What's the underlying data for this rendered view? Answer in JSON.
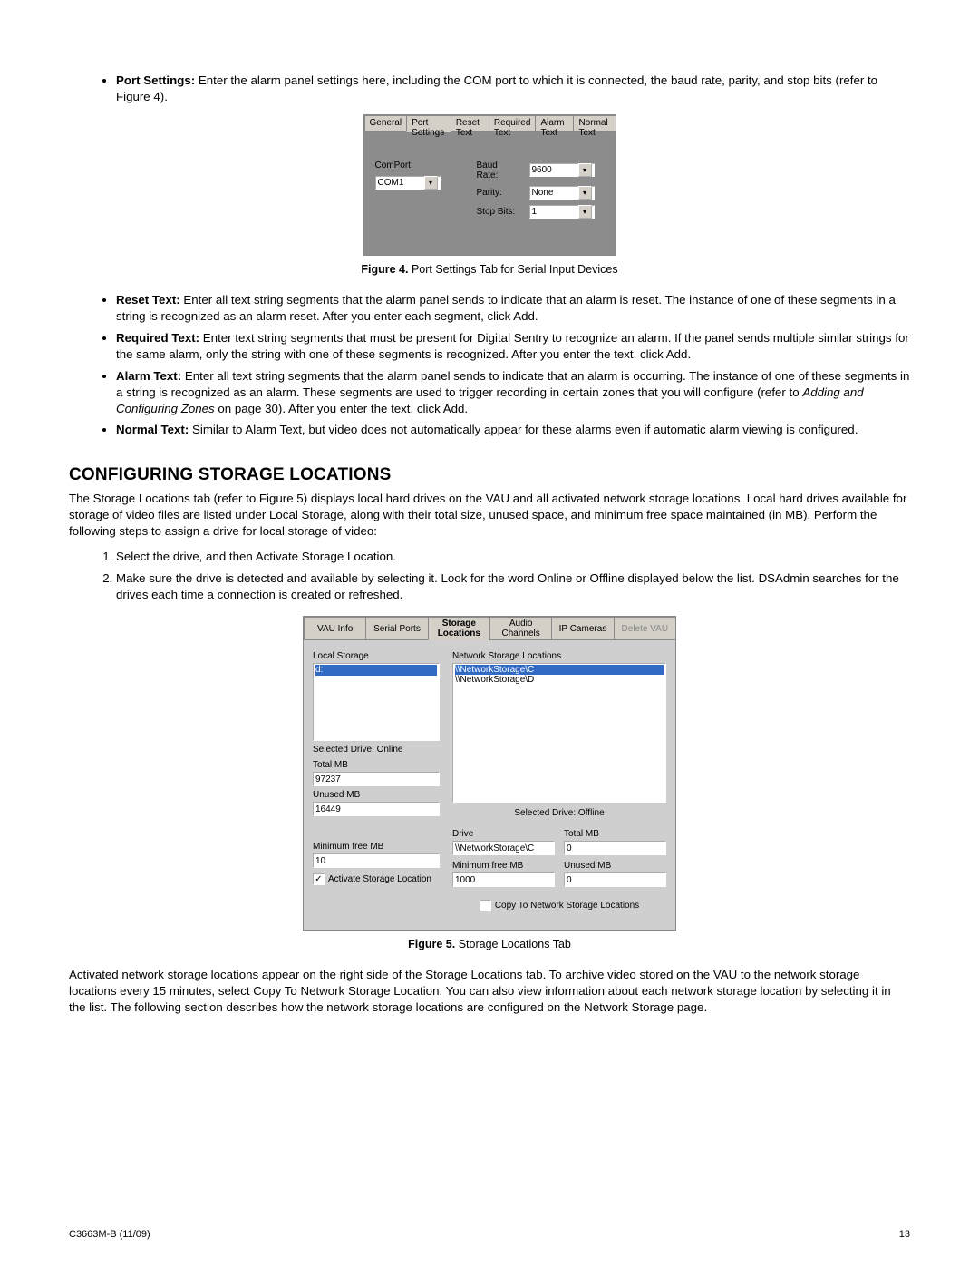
{
  "bullets1": {
    "port_settings_label": "Port Settings:",
    "port_settings_text": " Enter the alarm panel settings here, including the COM port to which it is connected, the baud rate, parity, and stop bits (refer to Figure 4)."
  },
  "fig4": {
    "tabs": [
      "General",
      "Port Settings",
      "Reset Text",
      "Required Text",
      "Alarm Text",
      "Normal Text"
    ],
    "comport_label": "ComPort:",
    "comport_value": "COM1",
    "baud_label": "Baud Rate:",
    "baud_value": "9600",
    "parity_label": "Parity:",
    "parity_value": "None",
    "stopbits_label": "Stop Bits:",
    "stopbits_value": "1",
    "caption_label": "Figure 4.",
    "caption_text": "  Port Settings Tab for Serial Input Devices"
  },
  "bullets2": {
    "reset_label": "Reset Text:",
    "reset_text": " Enter all text string segments that the alarm panel sends to indicate that an alarm is reset. The instance of one of these segments in a string is recognized as an alarm reset. After you enter each segment, click Add.",
    "required_label": "Required Text:",
    "required_text": " Enter text string segments that must be present for Digital Sentry to recognize an alarm. If the panel sends multiple similar strings for the same alarm, only the string with one of these segments is recognized. After you enter the text, click Add.",
    "alarm_label": "Alarm Text:",
    "alarm_text_a": " Enter all text string segments that the alarm panel sends to indicate that an alarm is occurring. The instance of one of these segments in a string is recognized as an alarm. These segments are used to trigger recording in certain zones that you will configure (refer to ",
    "alarm_text_italic": "Adding and Configuring Zones",
    "alarm_text_b": " on page 30). After you enter the text, click Add.",
    "normal_label": "Normal Text:",
    "normal_text": " Similar to Alarm Text, but video does not automatically appear for these alarms even if automatic alarm viewing is configured."
  },
  "section_heading": "CONFIGURING STORAGE LOCATIONS",
  "section_para": "The Storage Locations tab (refer to Figure 5) displays local hard drives on the VAU and all activated network storage locations. Local hard drives available for storage of video files are listed under Local Storage, along with their total size, unused space, and minimum free space maintained (in MB). Perform the following steps to assign a drive for local storage of video:",
  "steps": {
    "s1": "Select the drive, and then Activate Storage Location.",
    "s2": "Make sure the drive is detected and available by selecting it. Look for the word Online or Offline displayed below the list. DSAdmin searches for the drives each time a connection is created or refreshed."
  },
  "fig5": {
    "tabs": [
      "VAU Info",
      "Serial Ports",
      "Storage Locations",
      "Audio Channels",
      "IP Cameras",
      "Delete VAU"
    ],
    "local_storage_label": "Local Storage",
    "drive_item": "d:",
    "selected_drive_status": "Selected Drive: Online",
    "total_mb_label": "Total MB",
    "total_mb_value": "97237",
    "unused_mb_label": "Unused MB",
    "unused_mb_value": "16449",
    "min_free_label": "Minimum free MB",
    "min_free_value": "10",
    "activate_label": "Activate Storage Location",
    "net_loc_label": "Network Storage Locations",
    "net_item1": "\\\\NetworkStorage\\C",
    "net_item2": "\\\\NetworkStorage\\D",
    "net_selected_status": "Selected Drive: Offline",
    "drive_label": "Drive",
    "drive_value": "\\\\NetworkStorage\\C",
    "net_total_label": "Total MB",
    "net_total_value": "0",
    "net_min_label": "Minimum free MB",
    "net_min_value": "1000",
    "net_unused_label": "Unused MB",
    "net_unused_value": "0",
    "copy_label": "Copy To Network Storage Locations",
    "caption_label": "Figure 5.",
    "caption_text": "  Storage Locations Tab"
  },
  "closing_para": "Activated network storage locations appear on the right side of the Storage Locations tab. To archive video stored on the VAU to the network storage locations every 15 minutes, select Copy To Network Storage Location. You can also view information about each network storage location by selecting it in the list. The following section describes how the network storage locations are configured on the Network Storage page.",
  "footer_left": "C3663M-B (11/09)",
  "footer_right": "13"
}
